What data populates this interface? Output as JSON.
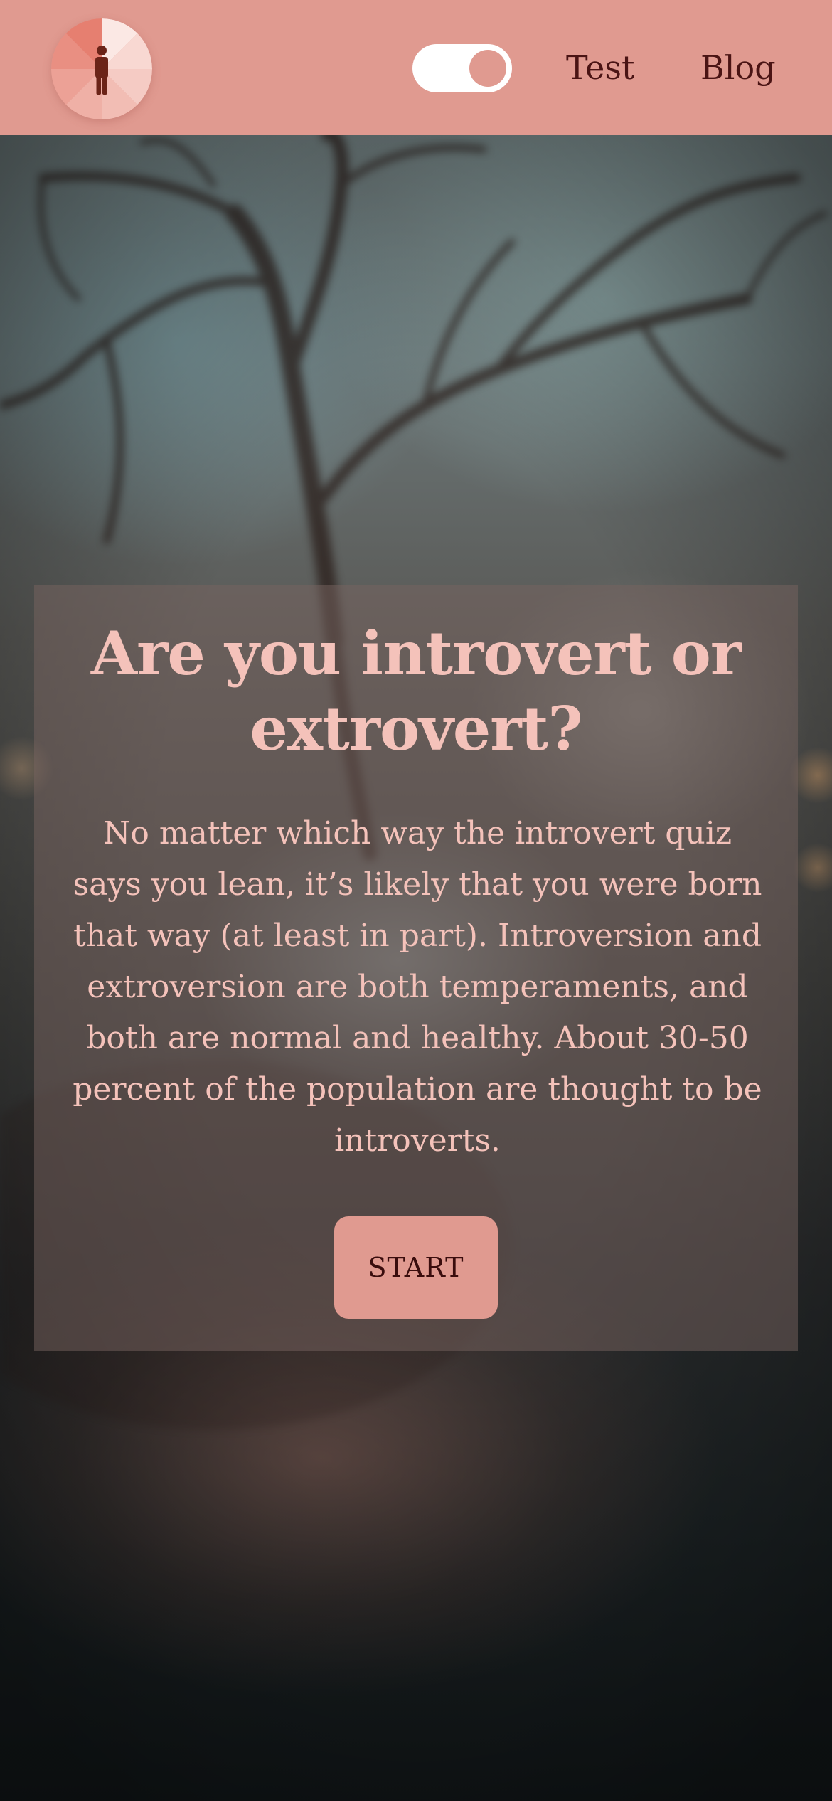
{
  "header": {
    "logo_icon": "person-in-circle-icon",
    "toggle": {
      "state": "on",
      "icon": "toggle-switch"
    },
    "nav": [
      {
        "label": "Test"
      },
      {
        "label": "Blog"
      }
    ]
  },
  "hero": {
    "title": "Are you introvert or extrovert?",
    "body": "No matter which way the introvert quiz says you lean, it’s likely that you were born that way (at least in part). Introversion and extroversion are both temperaments, and both are normal and healthy. About 30-50 percent of the population are thought to be introverts.",
    "cta_label": "START"
  },
  "colors": {
    "header_bg": "#e09a90",
    "text_dark": "#4a1414",
    "text_light": "#f4c2ba",
    "card_overlay": "rgba(120, 100, 96, 0.5)",
    "button_bg": "#e09a90"
  }
}
